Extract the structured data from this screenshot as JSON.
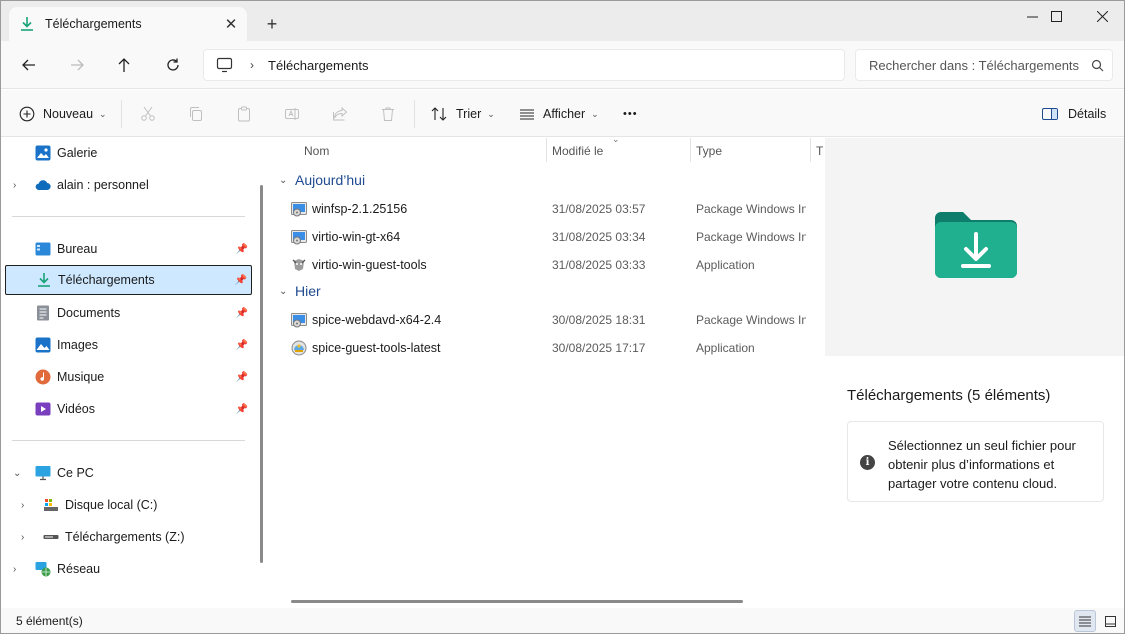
{
  "window": {
    "tab_title": "Téléchargements",
    "tab_close": "✕",
    "new_tab": "+"
  },
  "address": {
    "path": "Téléchargements",
    "separator": "›"
  },
  "search": {
    "placeholder": "Rechercher dans : Téléchargements"
  },
  "toolbar": {
    "new_label": "Nouveau",
    "sort_label": "Trier",
    "view_label": "Afficher",
    "more_label": "•••",
    "details_label": "Détails"
  },
  "sidebar": {
    "galerie": "Galerie",
    "onedrive": "alain : personnel",
    "pinned": [
      {
        "label": "Bureau"
      },
      {
        "label": "Téléchargements"
      },
      {
        "label": "Documents"
      },
      {
        "label": "Images"
      },
      {
        "label": "Musique"
      },
      {
        "label": "Vidéos"
      }
    ],
    "thispc": "Ce PC",
    "drive_c": "Disque local (C:)",
    "drive_z": "Téléchargements (Z:)",
    "network": "Réseau"
  },
  "columns": {
    "name": "Nom",
    "modified": "Modifié le",
    "type": "Type",
    "size": "T"
  },
  "groups": {
    "today": "Aujourd’hui",
    "yesterday": "Hier"
  },
  "files": [
    {
      "name": "winfsp-2.1.25156",
      "date": "31/08/2025 03:57",
      "type": "Package Windows Installer",
      "icon": "installer-icon"
    },
    {
      "name": "virtio-win-gt-x64",
      "date": "31/08/2025 03:34",
      "type": "Package Windows Installer",
      "icon": "installer-icon"
    },
    {
      "name": "virtio-win-guest-tools",
      "date": "31/08/2025 03:33",
      "type": "Application",
      "icon": "application-icon"
    },
    {
      "name": "spice-webdavd-x64-2.4",
      "date": "30/08/2025 18:31",
      "type": "Package Windows Installer",
      "icon": "installer-icon"
    },
    {
      "name": "spice-guest-tools-latest",
      "date": "30/08/2025 17:17",
      "type": "Application",
      "icon": "application-icon"
    }
  ],
  "details": {
    "title": "Téléchargements (5 éléments)",
    "info_icon": "i",
    "info": "Sélectionnez un seul fichier pour obtenir plus d’informations et partager votre contenu cloud."
  },
  "status": {
    "count": "5 élément(s)"
  },
  "colors": {
    "accent": "#1e4b8f",
    "download_green": "#1aa37a",
    "selection": "#cde8ff"
  }
}
